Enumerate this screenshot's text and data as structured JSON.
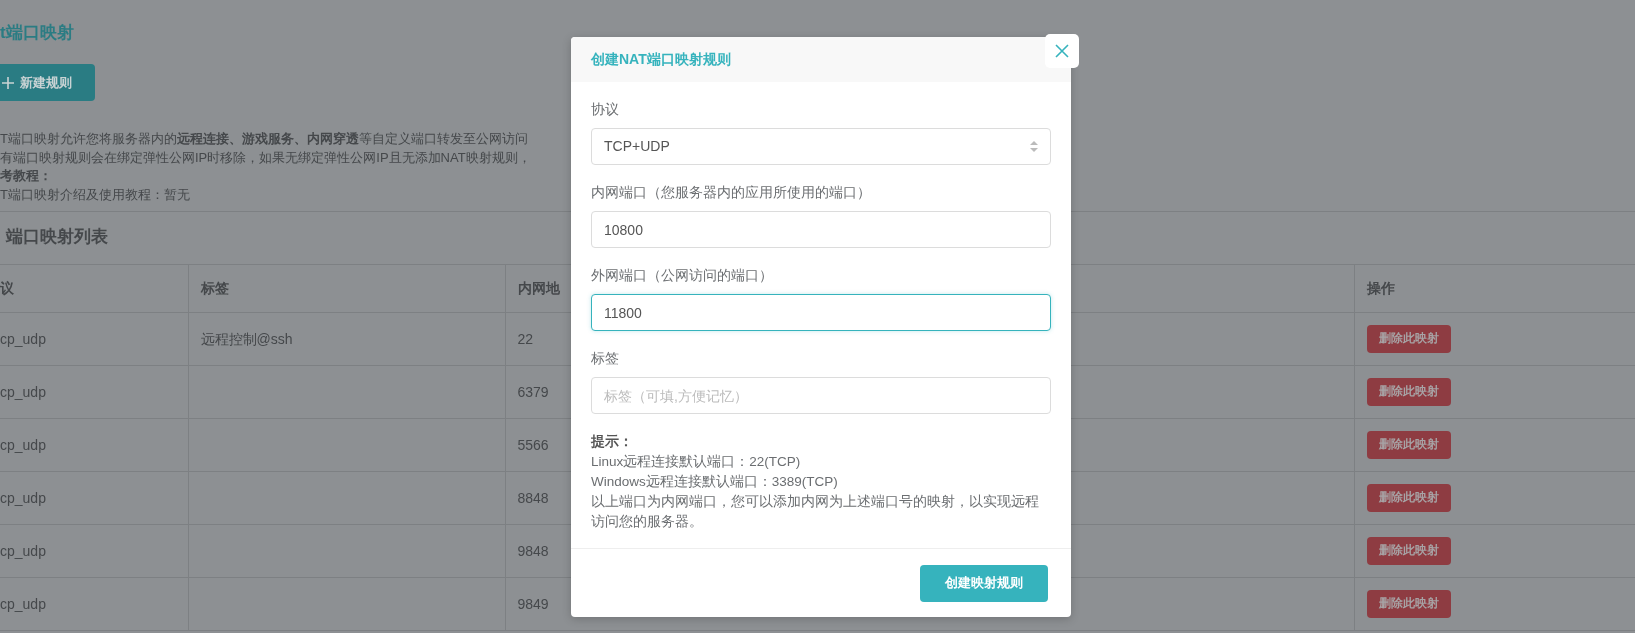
{
  "page": {
    "title": "t端口映射",
    "new_button": "新建规则",
    "description": [
      {
        "text": "T端口映射允许您将服务器内的**远程连接、游戏服务、内网穿透**等自定义端口转发至公网访问",
        "bold": false
      },
      {
        "text": "有端口映射规则会在绑定弹性公网IP时移除，如果无绑定弹性公网IP且无添加NAT映射规则，",
        "bold": false
      },
      {
        "text": "考教程：",
        "bold": true
      },
      {
        "text": "T端口映射介绍及使用教程：暂无",
        "bold": false
      }
    ],
    "list_title": "端口映射列表"
  },
  "table": {
    "columns": [
      "议",
      "标签",
      "内网地",
      "操作"
    ],
    "rows": [
      {
        "protocol": "cp_udp",
        "label": "远程控制@ssh",
        "internal": "22",
        "action": "删除此映射"
      },
      {
        "protocol": "cp_udp",
        "label": "",
        "internal": "6379",
        "action": "删除此映射"
      },
      {
        "protocol": "cp_udp",
        "label": "",
        "internal": "5566",
        "action": "删除此映射"
      },
      {
        "protocol": "cp_udp",
        "label": "",
        "internal": "8848",
        "action": "删除此映射"
      },
      {
        "protocol": "cp_udp",
        "label": "",
        "internal": "9848",
        "action": "删除此映射"
      },
      {
        "protocol": "cp_udp",
        "label": "",
        "internal": "9849",
        "action": "删除此映射"
      }
    ]
  },
  "dialog": {
    "title": "创建NAT端口映射规则",
    "fields": [
      {
        "kind": "select",
        "label": "协议",
        "value": "TCP+UDP",
        "focused": false
      },
      {
        "kind": "input",
        "label": "内网端口（您服务器内的应用所使用的端口）",
        "value": "10800",
        "focused": false
      },
      {
        "kind": "input",
        "label": "外网端口（公网访问的端口）",
        "value": "11800",
        "focused": true
      },
      {
        "kind": "input",
        "label": "标签",
        "placeholder": "标签（可填,方便记忆）",
        "focused": false
      }
    ],
    "tips_title": "提示：",
    "tips": [
      "Linux远程连接默认端口：22(TCP)",
      "Windows远程连接默认端口：3389(TCP)",
      "以上端口为内网端口，您可以添加内网为上述端口号的映射，以实现远程访问您的服务器。"
    ],
    "submit": "创建映射规则"
  }
}
